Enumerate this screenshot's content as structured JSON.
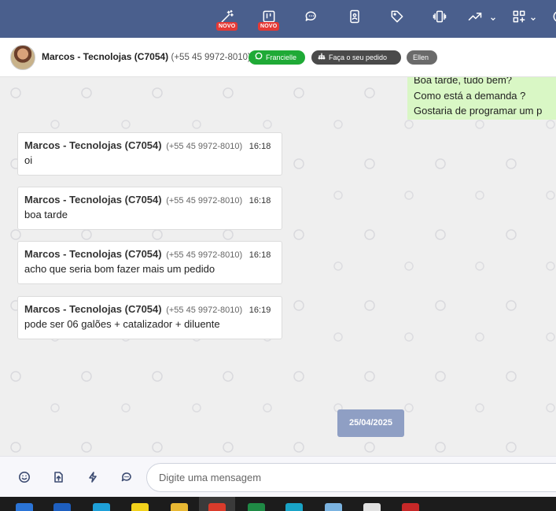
{
  "toolbar": {
    "icons": [
      {
        "name": "magic-wand-icon",
        "badge": "NOVO"
      },
      {
        "name": "kanban-board-icon",
        "badge": "NOVO"
      },
      {
        "name": "chat-bubbles-icon"
      },
      {
        "name": "contact-card-icon"
      },
      {
        "name": "tag-icon"
      },
      {
        "name": "phone-vibrate-icon"
      },
      {
        "name": "trending-up-icon"
      },
      {
        "name": "apps-grid-icon"
      }
    ]
  },
  "contact": {
    "name": "Marcos - Tecnolojas (C7054)",
    "phone": "(+55 45 9972-8010)",
    "pills": {
      "agent": "Francielle",
      "order": "Faça o seu pedido",
      "user": "Ellen"
    }
  },
  "outgoing": {
    "lines": [
      "Boa tarde, tudo bem?",
      "Como está a demanda ?",
      "Gostaria de programar um p"
    ]
  },
  "messages": [
    {
      "sender": "Marcos - Tecnolojas (C7054)",
      "phone": "(+55 45 9972-8010)",
      "time": "16:18",
      "text": "oi"
    },
    {
      "sender": "Marcos - Tecnolojas (C7054)",
      "phone": "(+55 45 9972-8010)",
      "time": "16:18",
      "text": "boa tarde"
    },
    {
      "sender": "Marcos - Tecnolojas (C7054)",
      "phone": "(+55 45 9972-8010)",
      "time": "16:18",
      "text": "acho que seria bom fazer mais um pedido"
    },
    {
      "sender": "Marcos - Tecnolojas (C7054)",
      "phone": "(+55 45 9972-8010)",
      "time": "16:19",
      "text": "pode ser 06 galões + catalizador + diluente"
    }
  ],
  "date_separator": "25/04/2025",
  "composer": {
    "placeholder": "Digite uma mensagem"
  },
  "colors": {
    "toolbar": "#4a5f8d",
    "outgoing_bubble": "#d9f7c5",
    "agent_pill": "#1faa36",
    "date_chip": "#8f9fc4",
    "badge": "#e53935"
  }
}
